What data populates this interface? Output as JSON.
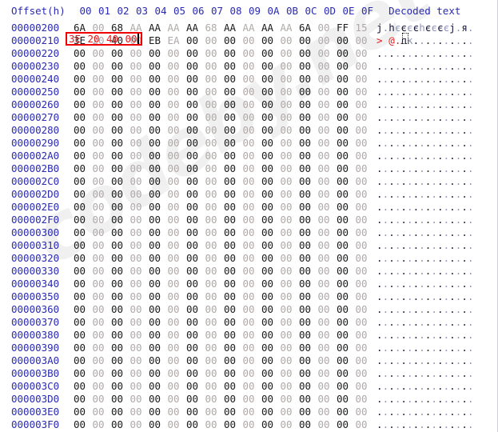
{
  "app": {
    "name": "hex-editor-view",
    "watermark": "codeby.net"
  },
  "header": {
    "offset_label": "Offset(h)",
    "column_labels": [
      "00",
      "01",
      "02",
      "03",
      "04",
      "05",
      "06",
      "07",
      "08",
      "09",
      "0A",
      "0B",
      "0C",
      "0D",
      "0E",
      "0F"
    ],
    "decoded_label": "Decoded text"
  },
  "selection": {
    "bytes": [
      "3E",
      "20",
      "40",
      "00"
    ],
    "row_offset": "00000210",
    "start_index": 0,
    "length": 4,
    "border_color": "#f00000",
    "text_color": "#e01b1b",
    "caret_visible": true
  },
  "colors": {
    "offset": "#2a2ab4",
    "byte_even": "#1a1a1a",
    "byte_odd": "#b0a8a8",
    "ascii_even": "#15153c",
    "ascii_odd": "#8f95b8",
    "selection_red": "#e01b1b",
    "watermark": "#f0f0f0",
    "background": "#ffffff"
  },
  "rows": [
    {
      "offset": "00000200",
      "bytes": [
        "6A",
        "00",
        "68",
        "AA",
        "AA",
        "AA",
        "AA",
        "68",
        "AA",
        "AA",
        "AA",
        "AA",
        "6A",
        "00",
        "FF",
        "15"
      ],
      "text": "j.hєєєєhєєєєj.я."
    },
    {
      "offset": "00000210",
      "bytes": [
        "3E",
        "20",
        "40",
        "00",
        "EB",
        "EA",
        "00",
        "00",
        "00",
        "00",
        "00",
        "00",
        "00",
        "00",
        "00",
        "00"
      ],
      "text": "> @.лк.........."
    },
    {
      "offset": "00000220",
      "bytes": [
        "00",
        "00",
        "00",
        "00",
        "00",
        "00",
        "00",
        "00",
        "00",
        "00",
        "00",
        "00",
        "00",
        "00",
        "00",
        "00"
      ],
      "text": "................"
    },
    {
      "offset": "00000230",
      "bytes": [
        "00",
        "00",
        "00",
        "00",
        "00",
        "00",
        "00",
        "00",
        "00",
        "00",
        "00",
        "00",
        "00",
        "00",
        "00",
        "00"
      ],
      "text": "................"
    },
    {
      "offset": "00000240",
      "bytes": [
        "00",
        "00",
        "00",
        "00",
        "00",
        "00",
        "00",
        "00",
        "00",
        "00",
        "00",
        "00",
        "00",
        "00",
        "00",
        "00"
      ],
      "text": "................"
    },
    {
      "offset": "00000250",
      "bytes": [
        "00",
        "00",
        "00",
        "00",
        "00",
        "00",
        "00",
        "00",
        "00",
        "00",
        "00",
        "00",
        "00",
        "00",
        "00",
        "00"
      ],
      "text": "................"
    },
    {
      "offset": "00000260",
      "bytes": [
        "00",
        "00",
        "00",
        "00",
        "00",
        "00",
        "00",
        "00",
        "00",
        "00",
        "00",
        "00",
        "00",
        "00",
        "00",
        "00"
      ],
      "text": "................"
    },
    {
      "offset": "00000270",
      "bytes": [
        "00",
        "00",
        "00",
        "00",
        "00",
        "00",
        "00",
        "00",
        "00",
        "00",
        "00",
        "00",
        "00",
        "00",
        "00",
        "00"
      ],
      "text": "................"
    },
    {
      "offset": "00000280",
      "bytes": [
        "00",
        "00",
        "00",
        "00",
        "00",
        "00",
        "00",
        "00",
        "00",
        "00",
        "00",
        "00",
        "00",
        "00",
        "00",
        "00"
      ],
      "text": "................"
    },
    {
      "offset": "00000290",
      "bytes": [
        "00",
        "00",
        "00",
        "00",
        "00",
        "00",
        "00",
        "00",
        "00",
        "00",
        "00",
        "00",
        "00",
        "00",
        "00",
        "00"
      ],
      "text": "................"
    },
    {
      "offset": "000002A0",
      "bytes": [
        "00",
        "00",
        "00",
        "00",
        "00",
        "00",
        "00",
        "00",
        "00",
        "00",
        "00",
        "00",
        "00",
        "00",
        "00",
        "00"
      ],
      "text": "................"
    },
    {
      "offset": "000002B0",
      "bytes": [
        "00",
        "00",
        "00",
        "00",
        "00",
        "00",
        "00",
        "00",
        "00",
        "00",
        "00",
        "00",
        "00",
        "00",
        "00",
        "00"
      ],
      "text": "................"
    },
    {
      "offset": "000002C0",
      "bytes": [
        "00",
        "00",
        "00",
        "00",
        "00",
        "00",
        "00",
        "00",
        "00",
        "00",
        "00",
        "00",
        "00",
        "00",
        "00",
        "00"
      ],
      "text": "................"
    },
    {
      "offset": "000002D0",
      "bytes": [
        "00",
        "00",
        "00",
        "00",
        "00",
        "00",
        "00",
        "00",
        "00",
        "00",
        "00",
        "00",
        "00",
        "00",
        "00",
        "00"
      ],
      "text": "................"
    },
    {
      "offset": "000002E0",
      "bytes": [
        "00",
        "00",
        "00",
        "00",
        "00",
        "00",
        "00",
        "00",
        "00",
        "00",
        "00",
        "00",
        "00",
        "00",
        "00",
        "00"
      ],
      "text": "................"
    },
    {
      "offset": "000002F0",
      "bytes": [
        "00",
        "00",
        "00",
        "00",
        "00",
        "00",
        "00",
        "00",
        "00",
        "00",
        "00",
        "00",
        "00",
        "00",
        "00",
        "00"
      ],
      "text": "................"
    },
    {
      "offset": "00000300",
      "bytes": [
        "00",
        "00",
        "00",
        "00",
        "00",
        "00",
        "00",
        "00",
        "00",
        "00",
        "00",
        "00",
        "00",
        "00",
        "00",
        "00"
      ],
      "text": "................"
    },
    {
      "offset": "00000310",
      "bytes": [
        "00",
        "00",
        "00",
        "00",
        "00",
        "00",
        "00",
        "00",
        "00",
        "00",
        "00",
        "00",
        "00",
        "00",
        "00",
        "00"
      ],
      "text": "................"
    },
    {
      "offset": "00000320",
      "bytes": [
        "00",
        "00",
        "00",
        "00",
        "00",
        "00",
        "00",
        "00",
        "00",
        "00",
        "00",
        "00",
        "00",
        "00",
        "00",
        "00"
      ],
      "text": "................"
    },
    {
      "offset": "00000330",
      "bytes": [
        "00",
        "00",
        "00",
        "00",
        "00",
        "00",
        "00",
        "00",
        "00",
        "00",
        "00",
        "00",
        "00",
        "00",
        "00",
        "00"
      ],
      "text": "................"
    },
    {
      "offset": "00000340",
      "bytes": [
        "00",
        "00",
        "00",
        "00",
        "00",
        "00",
        "00",
        "00",
        "00",
        "00",
        "00",
        "00",
        "00",
        "00",
        "00",
        "00"
      ],
      "text": "................"
    },
    {
      "offset": "00000350",
      "bytes": [
        "00",
        "00",
        "00",
        "00",
        "00",
        "00",
        "00",
        "00",
        "00",
        "00",
        "00",
        "00",
        "00",
        "00",
        "00",
        "00"
      ],
      "text": "................"
    },
    {
      "offset": "00000360",
      "bytes": [
        "00",
        "00",
        "00",
        "00",
        "00",
        "00",
        "00",
        "00",
        "00",
        "00",
        "00",
        "00",
        "00",
        "00",
        "00",
        "00"
      ],
      "text": "................"
    },
    {
      "offset": "00000370",
      "bytes": [
        "00",
        "00",
        "00",
        "00",
        "00",
        "00",
        "00",
        "00",
        "00",
        "00",
        "00",
        "00",
        "00",
        "00",
        "00",
        "00"
      ],
      "text": "................"
    },
    {
      "offset": "00000380",
      "bytes": [
        "00",
        "00",
        "00",
        "00",
        "00",
        "00",
        "00",
        "00",
        "00",
        "00",
        "00",
        "00",
        "00",
        "00",
        "00",
        "00"
      ],
      "text": "................"
    },
    {
      "offset": "00000390",
      "bytes": [
        "00",
        "00",
        "00",
        "00",
        "00",
        "00",
        "00",
        "00",
        "00",
        "00",
        "00",
        "00",
        "00",
        "00",
        "00",
        "00"
      ],
      "text": "................"
    },
    {
      "offset": "000003A0",
      "bytes": [
        "00",
        "00",
        "00",
        "00",
        "00",
        "00",
        "00",
        "00",
        "00",
        "00",
        "00",
        "00",
        "00",
        "00",
        "00",
        "00"
      ],
      "text": "................"
    },
    {
      "offset": "000003B0",
      "bytes": [
        "00",
        "00",
        "00",
        "00",
        "00",
        "00",
        "00",
        "00",
        "00",
        "00",
        "00",
        "00",
        "00",
        "00",
        "00",
        "00"
      ],
      "text": "................"
    },
    {
      "offset": "000003C0",
      "bytes": [
        "00",
        "00",
        "00",
        "00",
        "00",
        "00",
        "00",
        "00",
        "00",
        "00",
        "00",
        "00",
        "00",
        "00",
        "00",
        "00"
      ],
      "text": "................"
    },
    {
      "offset": "000003D0",
      "bytes": [
        "00",
        "00",
        "00",
        "00",
        "00",
        "00",
        "00",
        "00",
        "00",
        "00",
        "00",
        "00",
        "00",
        "00",
        "00",
        "00"
      ],
      "text": "................"
    },
    {
      "offset": "000003E0",
      "bytes": [
        "00",
        "00",
        "00",
        "00",
        "00",
        "00",
        "00",
        "00",
        "00",
        "00",
        "00",
        "00",
        "00",
        "00",
        "00",
        "00"
      ],
      "text": "................"
    },
    {
      "offset": "000003F0",
      "bytes": [
        "00",
        "00",
        "00",
        "00",
        "00",
        "00",
        "00",
        "00",
        "00",
        "00",
        "00",
        "00",
        "00",
        "00",
        "00",
        "00"
      ],
      "text": "................"
    }
  ]
}
